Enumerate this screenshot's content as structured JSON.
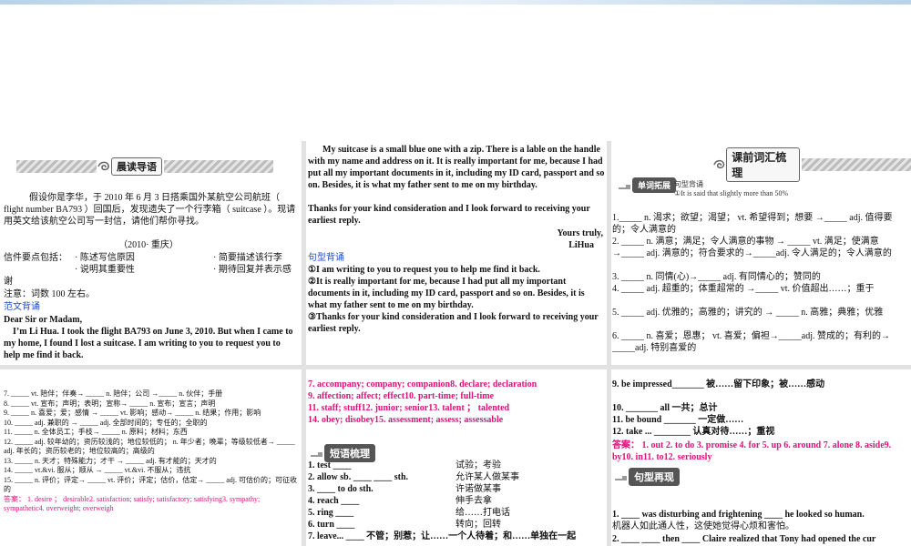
{
  "p1": {
    "banner_label": "晨读导语",
    "intro": "假设你是李华，于 2010 年 6 月 3 日搭乘国外某航空公司航班（ flight number BA793 ）回国后，发现遗失了一个行李箱（ suitcase ）。现请用英文给该航空公司写一封信，请他们帮你寻找。",
    "source": "（2010· 重庆）",
    "points_label": "信件要点包括：",
    "point1": "· 陈述写信原因",
    "point2": "· 简要描述该行李",
    "point3": "· 说明其重要性",
    "point4": "· 期待回复并表示感谢",
    "note": "注意：词数 100 左右。",
    "model_title": "范文背诵",
    "salutation": "Dear Sir or Madam,",
    "model_para": "I’m Li Hua. I took the flight BA793 on June 3, 2010. But when I came to my home, I found I lost a suitcase. I am writing to you to request you to help me find it back."
  },
  "p2": {
    "para1": "My suitcase is a small blue one with a zip. There is a lable on the handle with my name and address on it. It is really important for me, because I had put all my important documents in it, including my ID card, passport and so on. Besides, it is what my father sent to me on my birthday.",
    "para2": "Thanks for your kind consideration and I look forward to receiving your earliest reply.",
    "closing": "Yours truly,",
    "signature": "LiHua",
    "pattern_title": "句型背诵",
    "s1": "①I am writing to you to request you to help me find it back.",
    "s2": "②It is really important for me, because I had put all my important documents in it, including my ID card, passport and so on. Besides, it is what my father sent to me on my birthday.",
    "s3": "③Thanks for your kind consideration and I look forward to receiving your earliest reply."
  },
  "p3": {
    "title": "课前词汇梳理",
    "tag": "单词拓展",
    "pattern_label": "句型背诵",
    "pattern_text": "①It is said that slightly more than 50%",
    "items": [
      "1._____ n. 渴求；欲望；渴望； vt. 希望得到；想要 →_____ adj. 值得要的；令人满意的",
      "2. _____ n. 满意；满足；令人满意的事物 → _____ vt. 满足；使满意→_____ adj. 满意的；符合要求的→_____adj. 令人满足的；令人满意的",
      "3. _____ n. 同情(心)→_____ adj. 有同情心的；赞同的",
      "4. _____ adj. 超重的；体重超常的 →_____ vt. 价值超出……；重于",
      "5. _____ adj. 优雅的；高雅的；讲究的 → _____ n. 高雅；典雅；优雅",
      "6. _____ n. 喜爱；恩惠； vt. 喜爱；偏袒→_____adj. 赞成的；有利的→ _____adj. 特别喜爱的"
    ]
  },
  "p4": {
    "items": [
      "7. _____ vt. 陪伴；伴奏→ _____ n. 陪伴；公司 →_____ n. 伙伴；手册",
      "8. _____ vt. 宣布；声明；表明；宣称→ _____ n. 宣布；宣言；声明",
      "9. _____ n. 喜爱；爱；感情 → _____ vt. 影响；感动→ _____ n. 结果；作用；影响",
      "10. _____ adj. 兼职的 → _____ adj. 全部时间的；专任的；全职的",
      "11. _____ n. 全体员工；手枝→ _____ n. 原料；材料；东西",
      "12. _____ adj. 较年幼的；资历较浅的；地位较低的； n. 年少者；晚辈；等级较低者→ _____ adj. 年长的；资历较老的；地位较高的；高级的",
      "13. _____ n. 天才；特殊能力；才干 → _____ adj. 有才能的；天才的",
      "14. _____ vt.&vi. 服从；顺从 → _____ vt.&vi. 不服从；违抗",
      "15. _____ n. 评价；评定→ _____ vt. 评价；评定；估价，估定→ _____ adj. 可估价的；可征收的"
    ],
    "answers": "答案： 1. desire ； desirable2. satisfaction; satisfy; satisfactory; satisfying3. sympathy; sympathetic4. overweight; overweigh"
  },
  "p5": {
    "answers": [
      "7. accompany; company; companion8. declare; declaration",
      "9. affection; affect; effect10. part-time; full-time",
      "11. staff; stuff12. junior; senior13. talent ； talented",
      "14. obey; disobey15. assessment; assess; assessable"
    ],
    "phrase_title": "短语梳理",
    "phrases": [
      {
        "en": "1. test ____",
        "cn": "试验；考验"
      },
      {
        "en": "2. allow sb. ____ ____ sth.",
        "cn": "允许某人做某事"
      },
      {
        "en": "3. ____ to do sth.",
        "cn": "许诺做某事"
      },
      {
        "en": "4. reach ____",
        "cn": "伸手去拿"
      },
      {
        "en": "5. ring ____",
        "cn": "给……打电话"
      },
      {
        "en": "6. turn ____",
        "cn": "转向；回转"
      }
    ],
    "phrase7": "7. leave... ____ 不管；别惹；让……一个人待着；和……单独在一起"
  },
  "p6": {
    "item9": "9. be impressed_______ 被……留下印象；被……感动",
    "item10": "10. _______ all 一共；总计",
    "item11": "11. be bound _______ 一定做……",
    "item12": "12. take ... ________ 认真对待……；重视",
    "answers": "答案： 1. out 2. to do 3. promise 4. for 5. up 6. around 7. alone 8. aside9. by10. in11. to12. seriously",
    "section_title": "句型再现",
    "s1": "1. ____ was disturbing and frightening ____ he looked so human.",
    "s1cn": "机器人如此通人性，这使她觉得心烦和害怕。",
    "s2": "2. ____ ____ then ____ Claire realized that Tony had opened the cur"
  },
  "colors": {
    "blue": "#1f4fc3",
    "pink": "#e0107a"
  }
}
